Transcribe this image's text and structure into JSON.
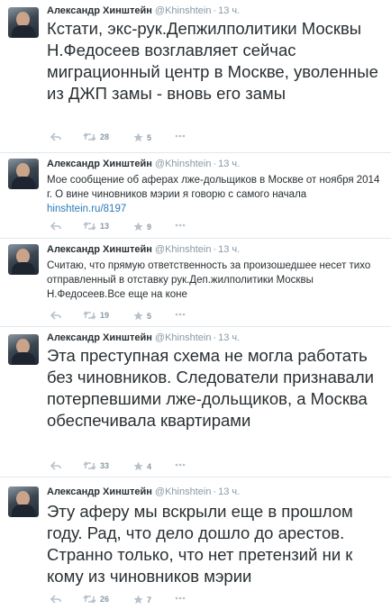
{
  "tweets": [
    {
      "name": "Александр Хинштейн",
      "handle": "@Khinshtein",
      "time": "13 ч.",
      "text": "Кстати, экс-рук.Депжилполитики Москвы Н.Федосеев возглавляет сейчас миграционный центр в Москве, уволенные из ДЖП замы - вновь его замы",
      "link": "",
      "retweets": "28",
      "favorites": "5"
    },
    {
      "name": "Александр Хинштейн",
      "handle": "@Khinshtein",
      "time": "13 ч.",
      "text": "Мое сообщение об аферах лже-дольщиков в Москве от ноября 2014 г. О вине чиновников мэрии я говорю с самого начала",
      "link": "hinshtein.ru/8197",
      "retweets": "13",
      "favorites": "9"
    },
    {
      "name": "Александр Хинштейн",
      "handle": "@Khinshtein",
      "time": "13 ч.",
      "text": "Считаю, что прямую ответственность за произошедшее несет тихо отправленный в отставку рук.Деп.жилполитики Москвы Н.Федосеев.Все еще на коне",
      "link": "",
      "retweets": "19",
      "favorites": "5"
    },
    {
      "name": "Александр Хинштейн",
      "handle": "@Khinshtein",
      "time": "13 ч.",
      "text": "Эта преступная схема не могла работать без чиновников. Следователи признавали потерпевшими лже-дольщиков, а Москва обеспечивала квартирами",
      "link": "",
      "retweets": "33",
      "favorites": "4"
    },
    {
      "name": "Александр Хинштейн",
      "handle": "@Khinshtein",
      "time": "13 ч.",
      "text": "Эту аферу мы вскрыли еще в прошлом году. Рад, что дело дошло до арестов. Странно только, что нет претензий ни к кому из чиновников мэрии",
      "link": "",
      "retweets": "26",
      "favorites": "7"
    }
  ],
  "icons": {
    "reply": "reply-icon",
    "retweet": "retweet-icon",
    "favorite": "favorite-star-icon",
    "more": "more-dots-icon"
  },
  "colors": {
    "name": "#292f33",
    "meta": "#8899a6",
    "link": "#2b7bb9",
    "border": "#e1e8ed"
  }
}
